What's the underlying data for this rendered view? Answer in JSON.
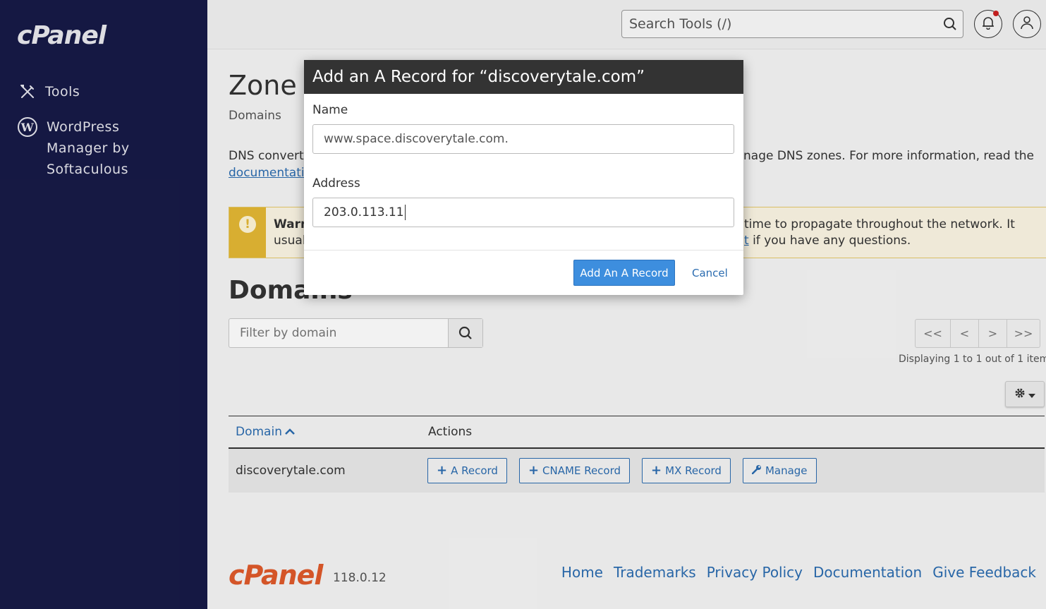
{
  "sidebar": {
    "logo": "cPanel",
    "items": [
      {
        "label": "Tools",
        "icon": "tools-icon"
      },
      {
        "label": "WordPress Manager by Softaculous",
        "icon": "wordpress-icon"
      }
    ]
  },
  "header": {
    "search_placeholder": "Search Tools (/)"
  },
  "main": {
    "title": "Zone E",
    "breadcrumb": "Domains",
    "description_left": "DNS converts",
    "description_right": "nage DNS zones. For more information, read the",
    "documentation_link": "documentati",
    "warning": {
      "title": "Warn",
      "left_line2": "usual",
      "right_line1": "time to propagate throughout the network. It",
      "right_link": "t",
      "right_line2": " if you have any questions."
    },
    "section_title": "Domains",
    "filter_placeholder": "Filter by domain",
    "pager": [
      "<<",
      "<",
      ">",
      ">>"
    ],
    "displaying": "Displaying 1 to 1 out of 1 item",
    "table": {
      "headers": {
        "domain": "Domain",
        "actions": "Actions"
      },
      "rows": [
        {
          "domain": "discoverytale.com",
          "actions": [
            "A Record",
            "CNAME Record",
            "MX Record",
            "Manage"
          ]
        }
      ]
    }
  },
  "footer": {
    "logo": "cPanel",
    "version": "118.0.12",
    "links": [
      "Home",
      "Trademarks",
      "Privacy Policy",
      "Documentation",
      "Give Feedback"
    ]
  },
  "modal": {
    "title": "Add an A Record for “discoverytale.com”",
    "name_label": "Name",
    "name_value": "www.space.discoverytale.com.",
    "address_label": "Address",
    "address_value": "203.0.113.11",
    "submit_label": "Add An A Record",
    "cancel_label": "Cancel"
  },
  "colors": {
    "sidebar_bg": "#171a47",
    "primary": "#3d8ede",
    "link": "#2b6cb0",
    "warning": "#e4b834",
    "brand_orange": "#e05a2b"
  }
}
